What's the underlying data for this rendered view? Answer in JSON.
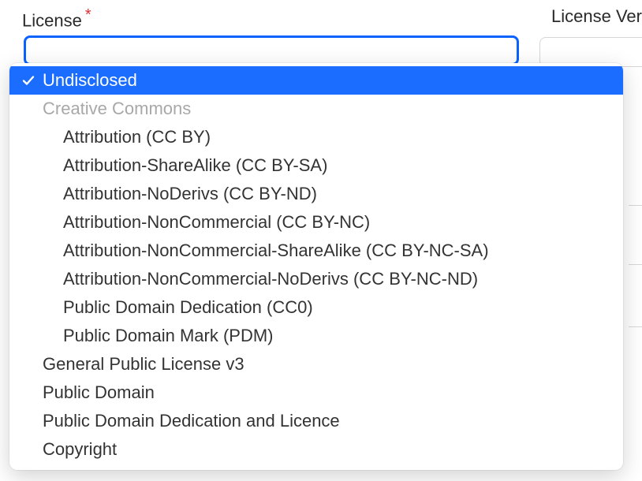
{
  "labels": {
    "license": "License",
    "required_mark": "*",
    "license_version_partial": "License Ver"
  },
  "dropdown": {
    "selected": "Undisclosed",
    "group_label": "Creative Commons",
    "cc_items": [
      "Attribution (CC BY)",
      "Attribution-ShareAlike (CC BY-SA)",
      "Attribution-NoDerivs (CC BY-ND)",
      "Attribution-NonCommercial (CC BY-NC)",
      "Attribution-NonCommercial-ShareAlike (CC BY-NC-SA)",
      "Attribution-NonCommercial-NoDerivs (CC BY-NC-ND)",
      "Public Domain Dedication (CC0)",
      "Public Domain Mark (PDM)"
    ],
    "plain_items": [
      "General Public License v3",
      "Public Domain",
      "Public Domain Dedication and Licence",
      "Copyright"
    ]
  }
}
